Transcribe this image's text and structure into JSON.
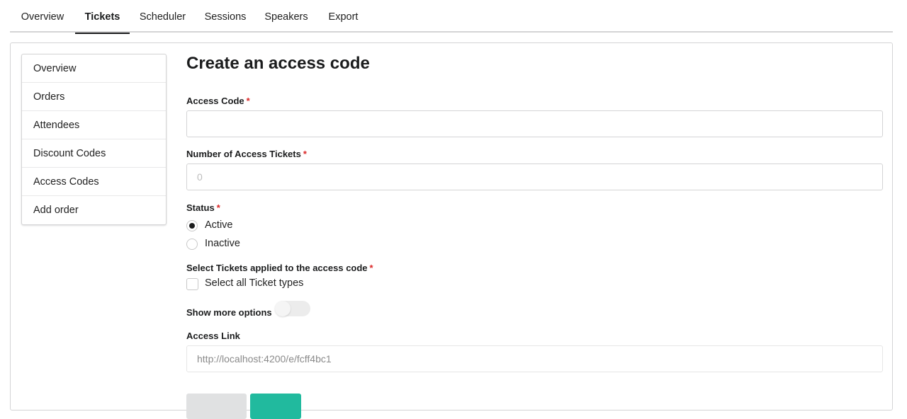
{
  "top_tabs": [
    {
      "label": "Overview"
    },
    {
      "label": "Tickets",
      "active": true
    },
    {
      "label": "Scheduler"
    },
    {
      "label": "Sessions"
    },
    {
      "label": "Speakers"
    },
    {
      "label": "Export"
    }
  ],
  "side_menu": [
    {
      "label": "Overview"
    },
    {
      "label": "Orders"
    },
    {
      "label": "Attendees"
    },
    {
      "label": "Discount Codes"
    },
    {
      "label": "Access Codes"
    },
    {
      "label": "Add order"
    }
  ],
  "form": {
    "title": "Create an access code",
    "access_code": {
      "label": "Access Code",
      "value": "",
      "required": "*"
    },
    "num_tickets": {
      "label": "Number of Access Tickets",
      "placeholder": "0",
      "required": "*"
    },
    "status": {
      "label": "Status",
      "required": "*",
      "options": [
        {
          "label": "Active",
          "checked": true
        },
        {
          "label": "Inactive",
          "checked": false
        }
      ]
    },
    "tickets": {
      "label": "Select Tickets applied to the access code",
      "required": "*",
      "select_all_label": "Select all Ticket types",
      "select_all_checked": false
    },
    "more_options": {
      "label": "Show more options",
      "enabled": false
    },
    "access_link": {
      "label": "Access Link",
      "value": "http://localhost:4200/e/fcff4bc1"
    }
  },
  "colors": {
    "accent": "#21ba9e",
    "required": "#db2828",
    "border": "#d4d4d5"
  }
}
